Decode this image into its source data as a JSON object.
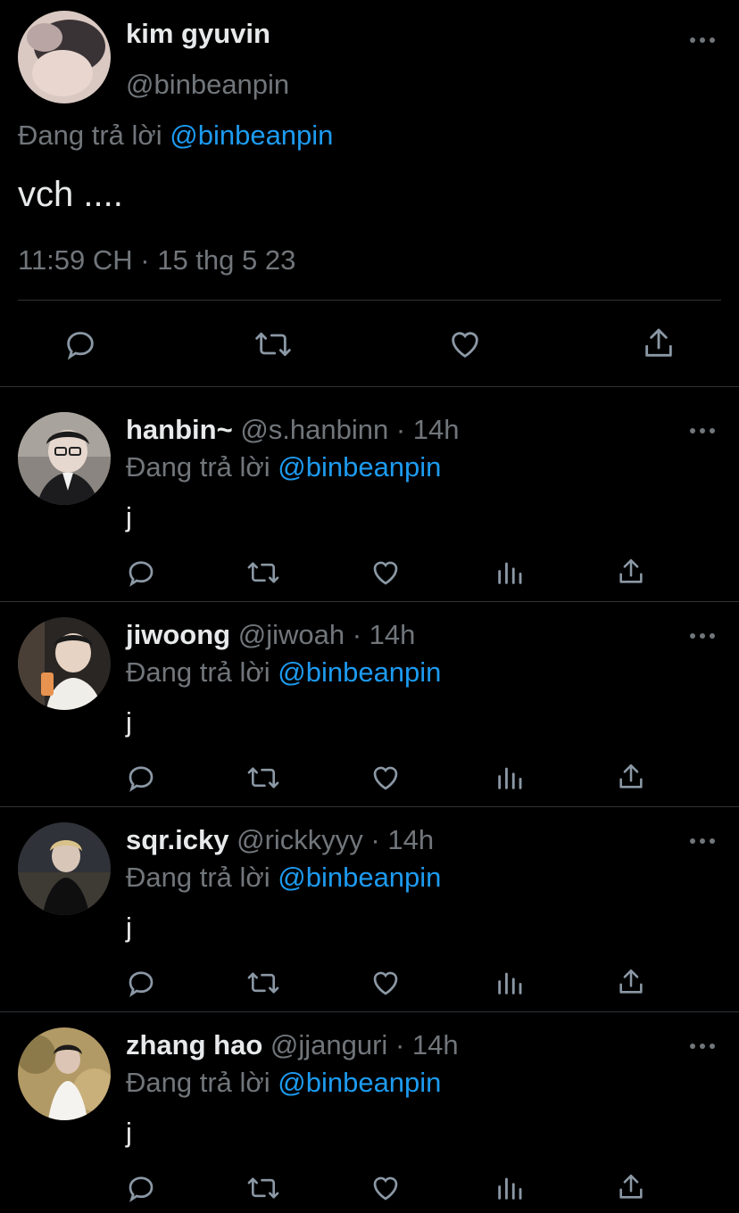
{
  "main_tweet": {
    "name": "kim gyuvin",
    "handle": "@binbeanpin",
    "replying_prefix": "Đang trả lời",
    "replying_to": "@binbeanpin",
    "text": "vch ....",
    "timestamp": "11:59 CH · 15 thg 5 23",
    "actions": [
      "reply-icon",
      "retweet-icon",
      "like-icon",
      "share-icon"
    ]
  },
  "replies": [
    {
      "name": "hanbin~",
      "handle": "@s.hanbinn",
      "time": "· 14h",
      "replying_prefix": "Đang trả lời",
      "replying_to": "@binbeanpin",
      "text": "j"
    },
    {
      "name": "jiwoong",
      "handle": "@jiwoah",
      "time": "· 14h",
      "replying_prefix": "Đang trả lời",
      "replying_to": "@binbeanpin",
      "text": "j"
    },
    {
      "name": "sqr.icky",
      "handle": "@rickkyyy",
      "time": "· 14h",
      "replying_prefix": "Đang trả lời",
      "replying_to": "@binbeanpin",
      "text": "j"
    },
    {
      "name": "zhang hao",
      "handle": "@jjanguri",
      "time": "· 14h",
      "replying_prefix": "Đang trả lời",
      "replying_to": "@binbeanpin",
      "text": "j"
    }
  ],
  "colors": {
    "background": "#000000",
    "text_primary": "#e7e9ea",
    "text_secondary": "#71767b",
    "accent": "#1d9bf0",
    "divider": "#2f3336"
  }
}
